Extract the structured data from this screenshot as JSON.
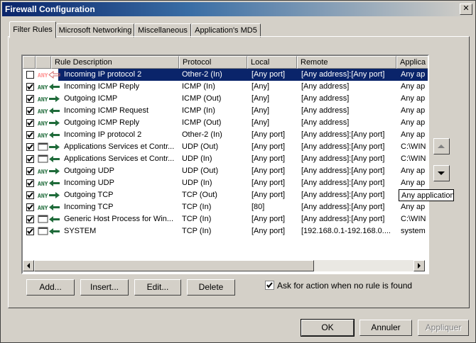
{
  "window": {
    "title": "Firewall Configuration",
    "close_glyph": "✕"
  },
  "tabs": [
    {
      "label": "Filter Rules",
      "active": true
    },
    {
      "label": "Microsoft Networking",
      "active": false
    },
    {
      "label": "Miscellaneous",
      "active": false
    },
    {
      "label": "Application's MD5",
      "active": false
    }
  ],
  "columns": [
    "Rule Description",
    "Protocol",
    "Local",
    "Remote",
    "Applica"
  ],
  "rules": [
    {
      "checked": false,
      "direction": "in",
      "selected": true,
      "description": "Incoming IP protocol 2",
      "protocol": "Other-2 (In)",
      "local": "[Any port]",
      "remote": "[Any address]:[Any port]",
      "application": "Any ap"
    },
    {
      "checked": true,
      "direction": "in",
      "description": "Incoming ICMP Reply",
      "protocol": "ICMP (In)",
      "local": "[Any]",
      "remote": "[Any address]",
      "application": "Any ap"
    },
    {
      "checked": true,
      "direction": "out",
      "description": "Outgoing ICMP",
      "protocol": "ICMP (Out)",
      "local": "[Any]",
      "remote": "[Any address]",
      "application": "Any ap"
    },
    {
      "checked": true,
      "direction": "in",
      "description": "Incoming ICMP Request",
      "protocol": "ICMP (In)",
      "local": "[Any]",
      "remote": "[Any address]",
      "application": "Any ap"
    },
    {
      "checked": true,
      "direction": "out",
      "description": "Outgoing ICMP Reply",
      "protocol": "ICMP (Out)",
      "local": "[Any]",
      "remote": "[Any address]",
      "application": "Any ap"
    },
    {
      "checked": true,
      "direction": "in",
      "description": "Incoming IP protocol 2",
      "protocol": "Other-2 (In)",
      "local": "[Any port]",
      "remote": "[Any address]:[Any port]",
      "application": "Any ap"
    },
    {
      "checked": true,
      "direction": "out",
      "app_icon": true,
      "description": "Applications Services et Contr...",
      "protocol": "UDP (Out)",
      "local": "[Any port]",
      "remote": "[Any address]:[Any port]",
      "application": "C:\\WIN"
    },
    {
      "checked": true,
      "direction": "in",
      "app_icon": true,
      "description": "Applications Services et Contr...",
      "protocol": "UDP (In)",
      "local": "[Any port]",
      "remote": "[Any address]:[Any port]",
      "application": "C:\\WIN"
    },
    {
      "checked": true,
      "direction": "out",
      "description": "Outgoing UDP",
      "protocol": "UDP (Out)",
      "local": "[Any port]",
      "remote": "[Any address]:[Any port]",
      "application": "Any ap"
    },
    {
      "checked": true,
      "direction": "in",
      "description": "Incoming UDP",
      "protocol": "UDP (In)",
      "local": "[Any port]",
      "remote": "[Any address]:[Any port]",
      "application": "Any ap"
    },
    {
      "checked": true,
      "direction": "out",
      "description": "Outgoing TCP",
      "protocol": "TCP (Out)",
      "local": "[Any port]",
      "remote": "[Any address]:[Any port]",
      "application": "Any application"
    },
    {
      "checked": true,
      "direction": "in",
      "description": "Incoming TCP",
      "protocol": "TCP (In)",
      "local": "[80]",
      "remote": "[Any address]:[Any port]",
      "application": "Any ap"
    },
    {
      "checked": true,
      "direction": "in",
      "app_icon": true,
      "description": "Generic Host Process for Win...",
      "protocol": "TCP (In)",
      "local": "[Any port]",
      "remote": "[Any address]:[Any port]",
      "application": "C:\\WIN"
    },
    {
      "checked": true,
      "direction": "in",
      "app_icon": true,
      "description": "SYSTEM",
      "protocol": "TCP (In)",
      "local": "[Any port]",
      "remote": "[192.168.0.1-192.168.0....",
      "application": "system"
    }
  ],
  "tooltip": "Any application",
  "icon_labels": {
    "any": "ANY"
  },
  "buttons": {
    "add": "Add...",
    "insert": "Insert...",
    "edit": "Edit...",
    "delete": "Delete",
    "ok": "OK",
    "cancel": "Annuler",
    "apply": "Appliquer"
  },
  "ask_option": {
    "label": "Ask for action when no rule is found",
    "checked": true
  },
  "colors": {
    "selection": "#0a246a",
    "arrow": "#1f6b3a",
    "arrow_in_selected": "#d46a6a",
    "face": "#d4d0c8"
  }
}
